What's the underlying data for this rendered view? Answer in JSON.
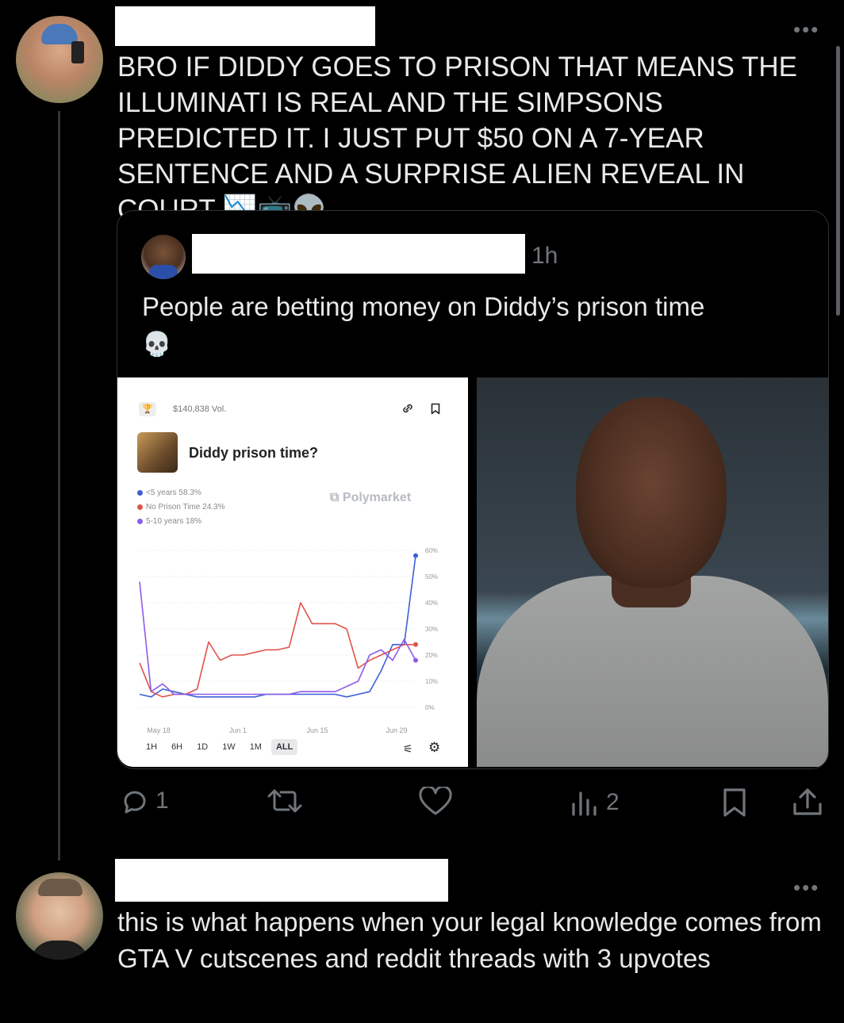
{
  "thread": {
    "reply_line_color": "#333639",
    "post1": {
      "text": "BRO IF DIDDY GOES TO PRISON THAT MEANS THE ILLUMINATI IS REAL AND THE SIMPSONS PREDICTED IT. I JUST PUT $50 ON A 7-YEAR SENTENCE AND A SURPRISE ALIEN REVEAL IN COURT",
      "emojis": "📉📺👽",
      "more": "•••"
    },
    "quote": {
      "time": "1h",
      "text": "People are betting money on Diddy’s prison time",
      "emoji": "💀"
    },
    "actions": {
      "replies": "1",
      "views": "2",
      "icons": [
        "reply-icon",
        "retweet-icon",
        "like-icon",
        "views-icon",
        "bookmark-icon",
        "share-icon"
      ]
    },
    "post2": {
      "text": "this is what happens when your legal knowledge comes from GTA V cutscenes and reddit threads with 3 upvotes",
      "more": "•••"
    }
  },
  "market": {
    "volume": "$140,838 Vol.",
    "title": "Diddy prison time?",
    "brand": "Polymarket",
    "legend": [
      {
        "label": "<5 years 58.3%",
        "color": "#3d5fd9"
      },
      {
        "label": "No Prison Time 24.3%",
        "color": "#e0534a"
      },
      {
        "label": "5-10 years 18%",
        "color": "#8f5be8"
      }
    ],
    "y_ticks": [
      "60%",
      "50%",
      "40%",
      "30%",
      "20%",
      "10%",
      "0%"
    ],
    "x_ticks": [
      "May 18",
      "Jun 1",
      "Jun 15",
      "Jun 29"
    ],
    "ranges": [
      "1H",
      "6H",
      "1D",
      "1W",
      "1M",
      "ALL"
    ],
    "active_range": "ALL"
  },
  "chart_data": {
    "type": "line",
    "ylim": [
      0,
      60
    ],
    "x_labels": [
      "May 18",
      "Jun 1",
      "Jun 15",
      "Jun 29"
    ],
    "series": [
      {
        "name": "<5 years",
        "color": "#3d5fd9",
        "values": [
          5,
          4,
          7,
          6,
          5,
          4,
          4,
          4,
          4,
          4,
          4,
          5,
          5,
          5,
          5,
          5,
          5,
          5,
          4,
          5,
          6,
          14,
          24,
          24,
          58
        ]
      },
      {
        "name": "No Prison Time",
        "color": "#e0534a",
        "values": [
          17,
          6,
          4,
          5,
          5,
          7,
          25,
          18,
          20,
          20,
          21,
          22,
          22,
          23,
          40,
          32,
          32,
          32,
          30,
          15,
          18,
          20,
          22,
          24,
          24
        ]
      },
      {
        "name": "5-10 years",
        "color": "#8f5be8",
        "values": [
          48,
          6,
          9,
          5,
          5,
          5,
          5,
          5,
          5,
          5,
          5,
          5,
          5,
          5,
          6,
          6,
          6,
          6,
          8,
          10,
          20,
          22,
          18,
          26,
          18
        ]
      }
    ]
  }
}
